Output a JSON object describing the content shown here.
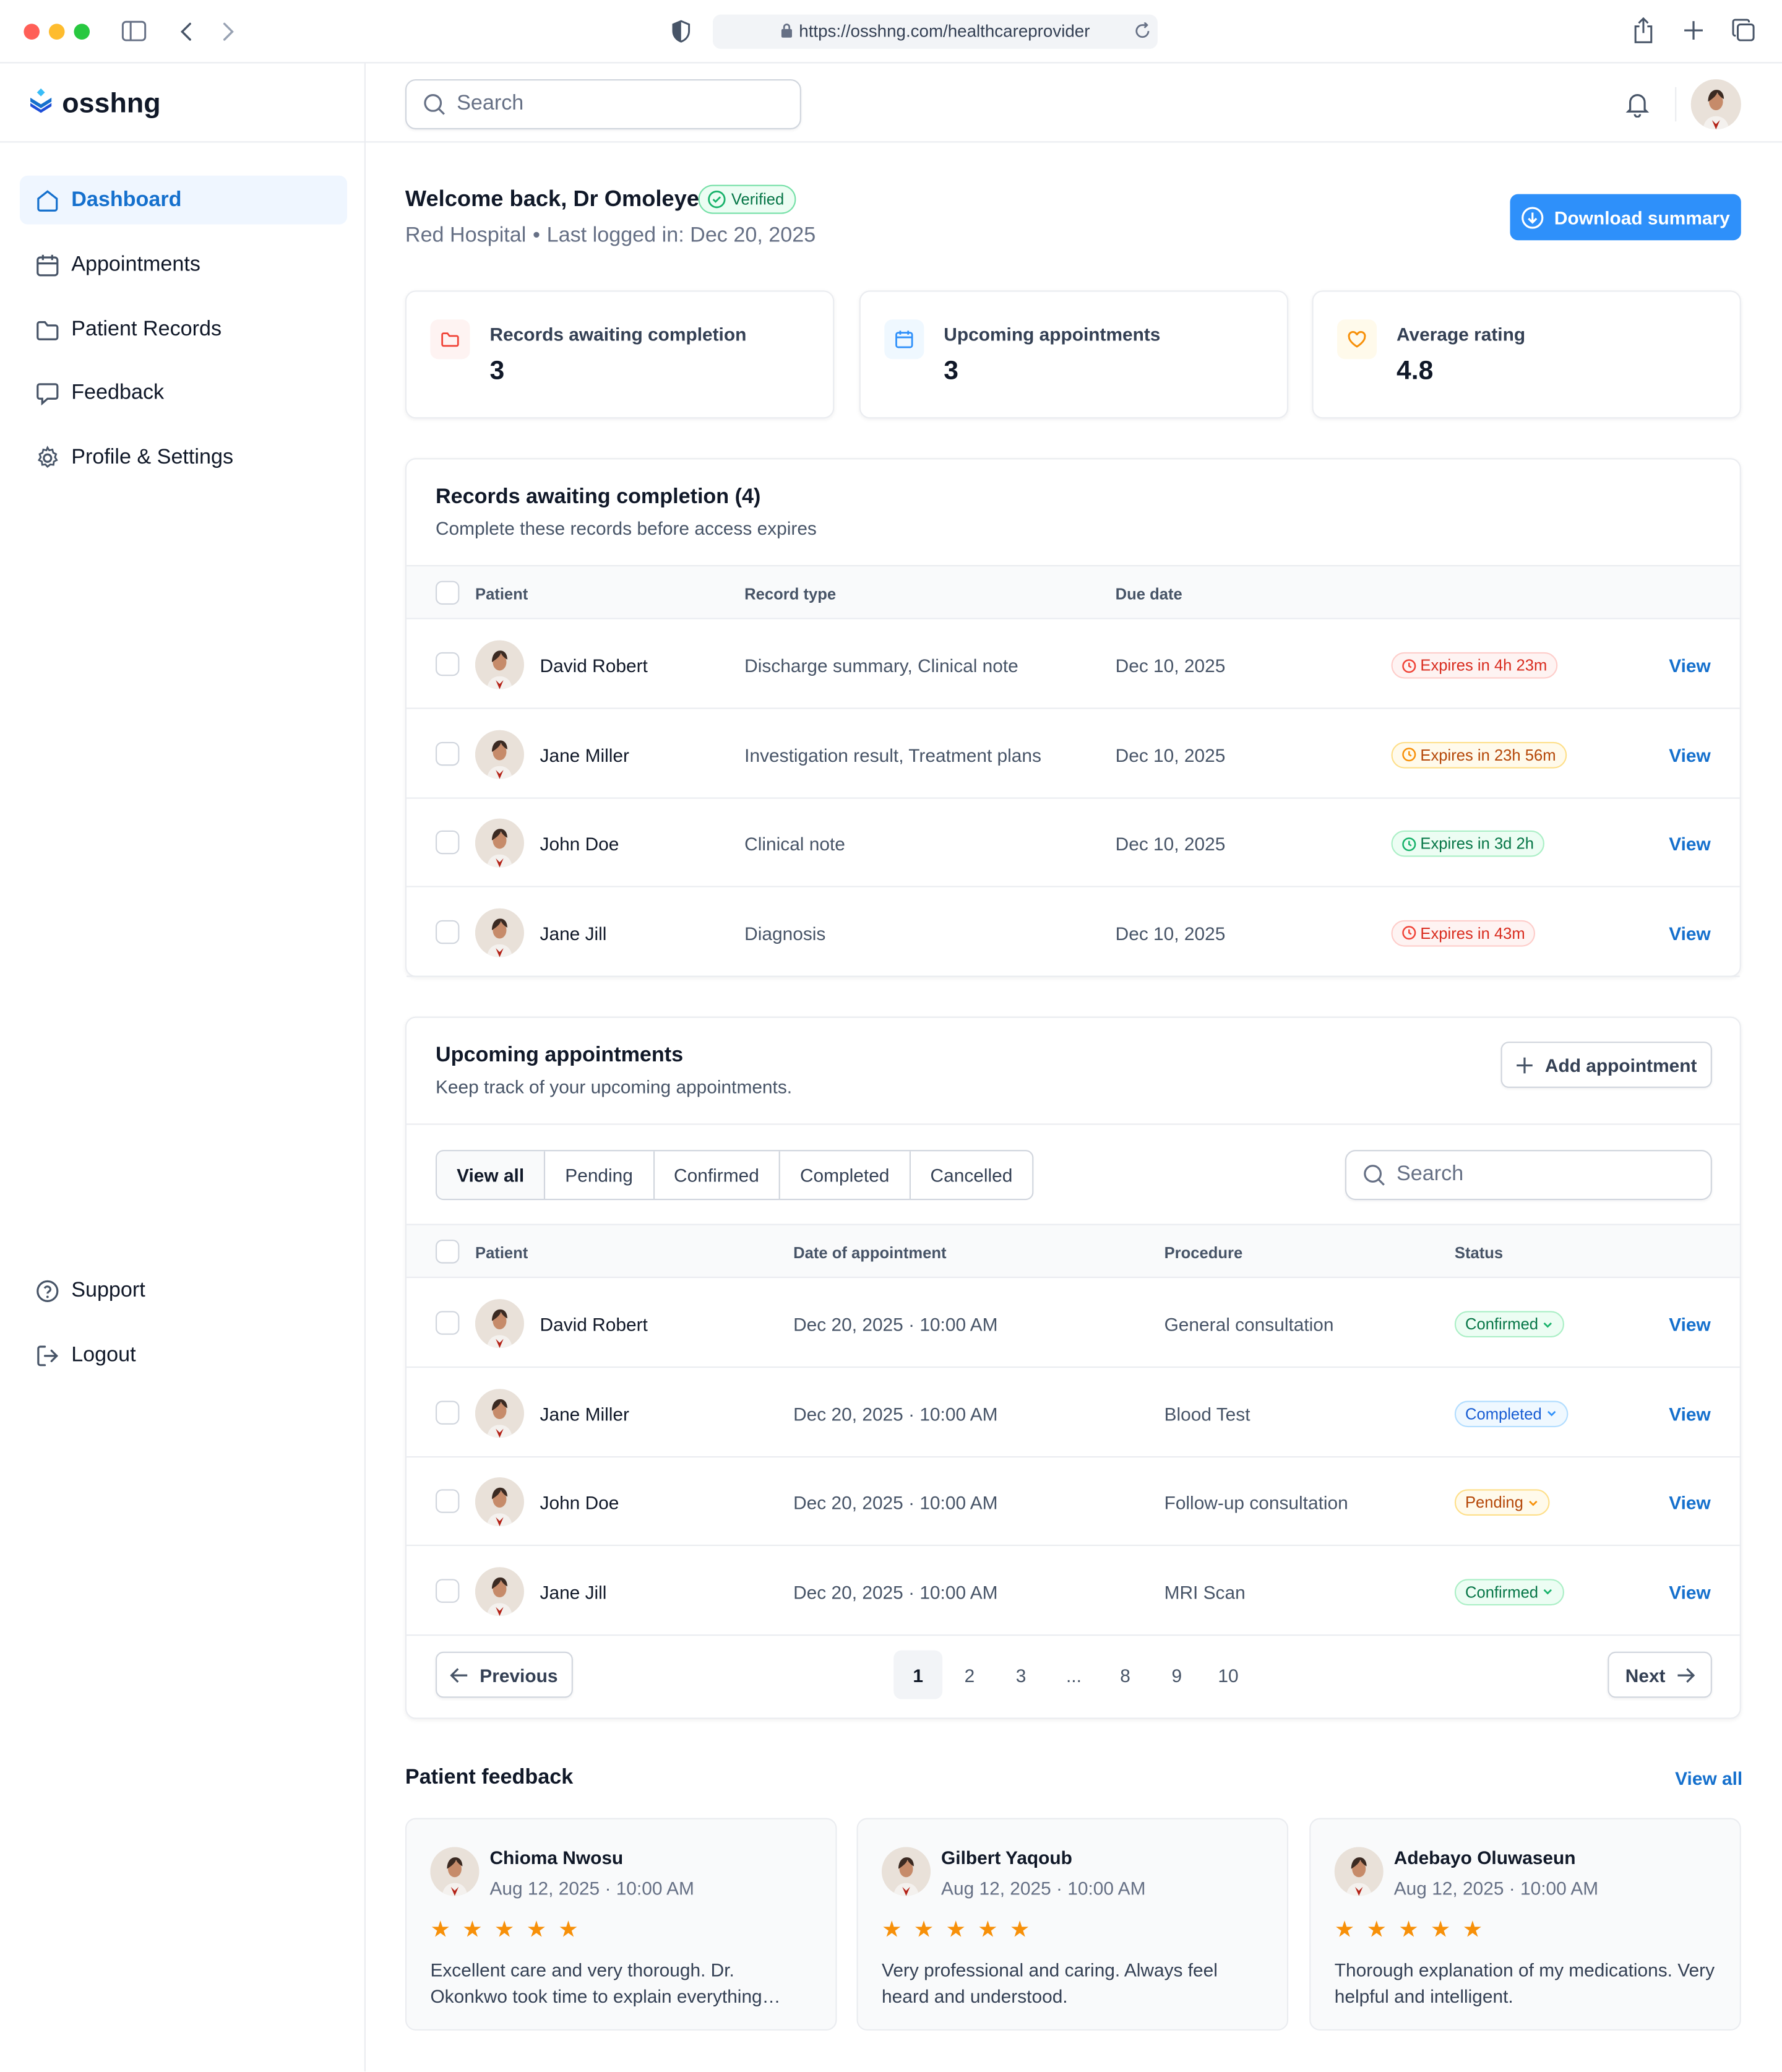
{
  "browser": {
    "url": "https://osshng.com/healthcareprovider"
  },
  "brand": {
    "name": "osshng",
    "accent": "#1570cd"
  },
  "nav": {
    "items": [
      {
        "label": "Dashboard",
        "icon": "home-icon"
      },
      {
        "label": "Appointments",
        "icon": "calendar-icon"
      },
      {
        "label": "Patient Records",
        "icon": "folder-icon"
      },
      {
        "label": "Feedback",
        "icon": "chat-icon"
      },
      {
        "label": "Profile & Settings",
        "icon": "gear-icon"
      }
    ],
    "bottom": [
      {
        "label": "Support",
        "icon": "help-icon"
      },
      {
        "label": "Logout",
        "icon": "logout-icon"
      }
    ]
  },
  "header": {
    "search_placeholder": "Search"
  },
  "welcome": {
    "title": "Welcome back, Dr Omoleye",
    "badge": "Verified",
    "hospital": "Red Hospital",
    "separator": "•",
    "last_login": "Last logged in: Dec 20, 2025",
    "download_label": "Download summary"
  },
  "stats": [
    {
      "label": "Records awaiting completion",
      "value": "3"
    },
    {
      "label": "Upcoming appointments",
      "value": "3"
    },
    {
      "label": "Average rating",
      "value": "4.8"
    }
  ],
  "records": {
    "title": "Records awaiting completion (4)",
    "subtitle": "Complete these records before access expires",
    "columns": [
      "Patient",
      "Record type",
      "Due date"
    ],
    "rows": [
      {
        "patient": "David Robert",
        "type": "Discharge summary, Clinical note",
        "due": "Dec 10, 2025",
        "expires": "Expires in 4h 23m",
        "tone": "red",
        "action": "View"
      },
      {
        "patient": "Jane Miller",
        "type": "Investigation result, Treatment plans",
        "due": "Dec 10, 2025",
        "expires": "Expires in 23h 56m",
        "tone": "amber",
        "action": "View"
      },
      {
        "patient": "John Doe",
        "type": "Clinical note",
        "due": "Dec 10, 2025",
        "expires": "Expires in 3d 2h",
        "tone": "green",
        "action": "View"
      },
      {
        "patient": "Jane Jill",
        "type": "Diagnosis",
        "due": "Dec 10, 2025",
        "expires": "Expires in 43m",
        "tone": "red",
        "action": "View"
      }
    ]
  },
  "appointments": {
    "title": "Upcoming appointments",
    "subtitle": "Keep track of your upcoming appointments.",
    "add_label": "Add appointment",
    "tabs": [
      "View all",
      "Pending",
      "Confirmed",
      "Completed",
      "Cancelled"
    ],
    "search_placeholder": "Search",
    "columns": [
      "Patient",
      "Date of appointment",
      "Procedure",
      "Status"
    ],
    "rows": [
      {
        "patient": "David Robert",
        "date": "Dec 20, 2025 · 10:00 AM",
        "procedure": "General consultation",
        "status": "Confirmed",
        "tone": "green",
        "action": "View"
      },
      {
        "patient": "Jane Miller",
        "date": "Dec 20, 2025 · 10:00 AM",
        "procedure": "Blood Test",
        "status": "Completed",
        "tone": "blue",
        "action": "View"
      },
      {
        "patient": "John Doe",
        "date": "Dec 20, 2025 · 10:00 AM",
        "procedure": "Follow-up consultation",
        "status": "Pending",
        "tone": "amber",
        "action": "View"
      },
      {
        "patient": "Jane Jill",
        "date": "Dec 20, 2025 · 10:00 AM",
        "procedure": "MRI Scan",
        "status": "Confirmed",
        "tone": "green",
        "action": "View"
      }
    ],
    "pagination": {
      "prev": "Previous",
      "next": "Next",
      "pages": [
        "1",
        "2",
        "3",
        "...",
        "8",
        "9",
        "10"
      ],
      "current": "1"
    }
  },
  "feedback": {
    "title": "Patient feedback",
    "view_all": "View all",
    "items": [
      {
        "name": "Chioma Nwosu",
        "date": "Aug 12, 2025 · 10:00 AM",
        "stars": "★★★★★",
        "text": "Excellent care and very thorough. Dr. Okonkwo took time to explain everything clearly and patiently."
      },
      {
        "name": "Gilbert Yaqoub",
        "date": "Aug 12, 2025 · 10:00 AM",
        "stars": "★★★★★",
        "text": "Very professional and caring. Always feel heard and understood."
      },
      {
        "name": "Adebayo Oluwaseun",
        "date": "Aug 12, 2025 · 10:00 AM",
        "stars": "★★★★★",
        "text": "Thorough explanation of my medications. Very helpful and intelligent."
      }
    ]
  }
}
